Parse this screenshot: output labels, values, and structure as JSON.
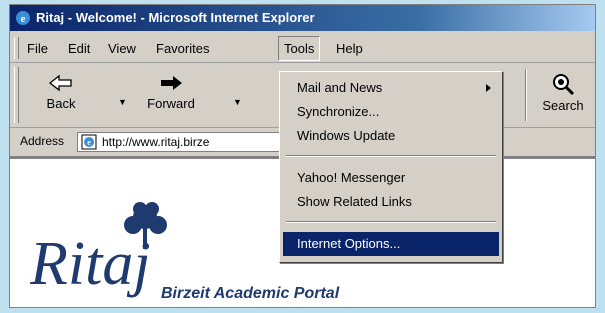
{
  "window": {
    "title": "Ritaj - Welcome! - Microsoft Internet Explorer"
  },
  "menubar": {
    "items": [
      {
        "label": "File"
      },
      {
        "label": "Edit"
      },
      {
        "label": "View"
      },
      {
        "label": "Favorites"
      },
      {
        "label": "Tools"
      },
      {
        "label": "Help"
      }
    ]
  },
  "toolbar": {
    "back_label": "Back",
    "forward_label": "Forward",
    "search_label": "Search"
  },
  "address": {
    "label": "Address",
    "url": "http://www.ritaj.birze"
  },
  "tools_menu": {
    "items": [
      {
        "label": "Mail and News",
        "has_submenu": true
      },
      {
        "label": "Synchronize..."
      },
      {
        "label": "Windows Update"
      },
      {
        "label": "Yahoo! Messenger"
      },
      {
        "label": "Show Related Links"
      },
      {
        "label": "Internet Options...",
        "selected": true
      }
    ]
  },
  "page": {
    "logo_text": "Ritaj",
    "portal_name": "Birzeit Academic Portal"
  },
  "colors": {
    "title_bar": "#0a246a",
    "selection": "#0a246a",
    "chrome": "#d4d0c8",
    "logo_blue": "#1f3a6e"
  }
}
